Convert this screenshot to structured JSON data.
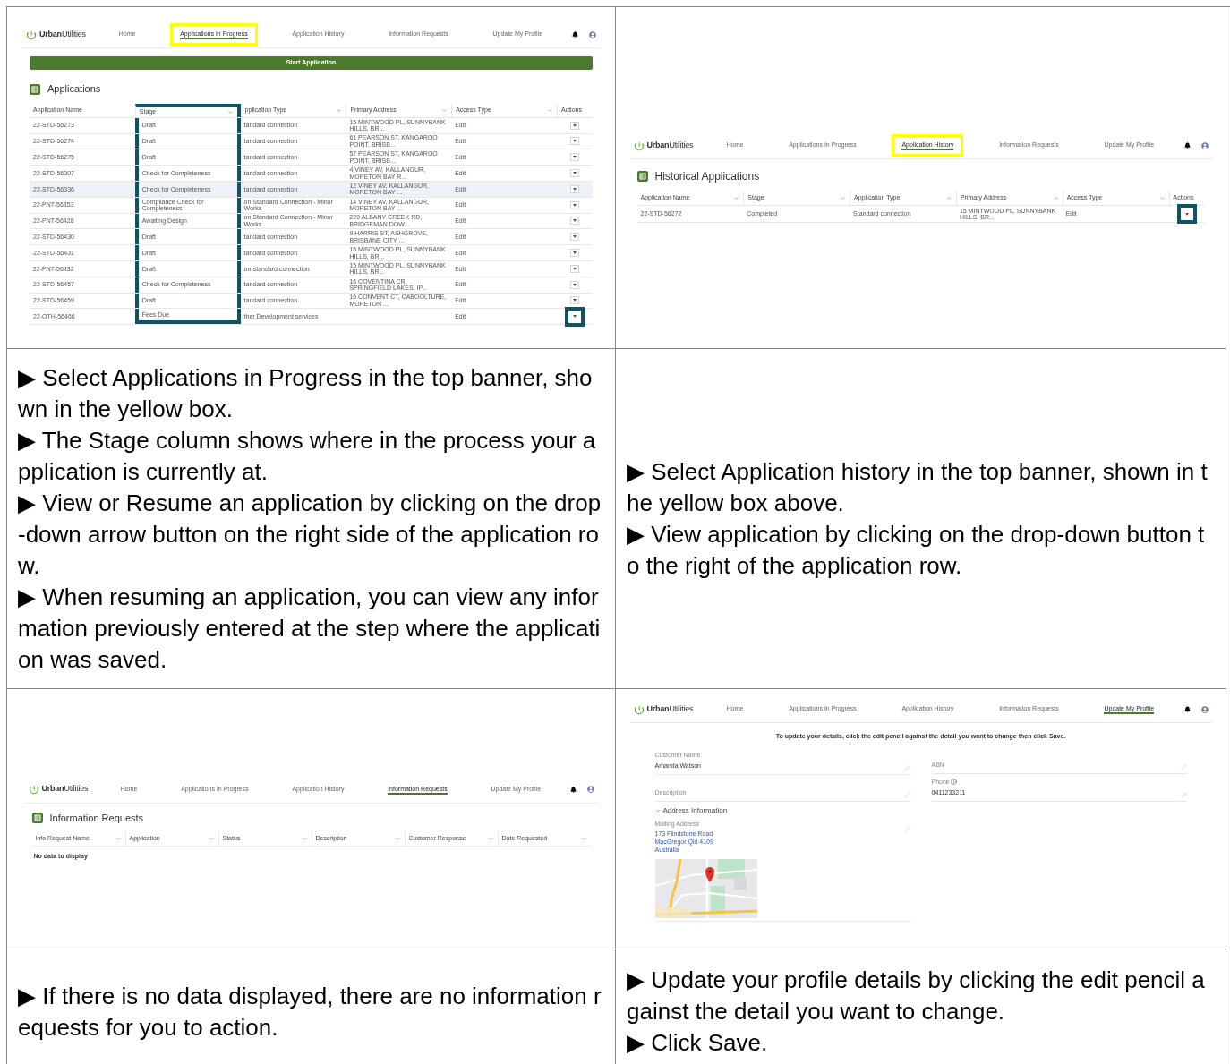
{
  "screens": [
    {
      "kind": "applications",
      "nav": {
        "logo": "**Urban**Utilities",
        "items": [
          {
            "label": "Home",
            "selected": false,
            "highlighted": false
          },
          {
            "label": "Applications In Progress",
            "selected": true,
            "highlighted": true
          },
          {
            "label": "Application History",
            "selected": false,
            "highlighted": false
          },
          {
            "label": "Information Requests",
            "selected": false,
            "highlighted": false
          },
          {
            "label": "Update My Profile",
            "selected": false,
            "highlighted": false
          }
        ]
      },
      "start_button": "Start Application",
      "title": "Applications",
      "columns": [
        {
          "label": "Application Name",
          "sortable": false,
          "highlighted": false
        },
        {
          "label": "Stage",
          "sortable": true,
          "highlighted": true
        },
        {
          "label": "pplication Type",
          "sortable": true,
          "highlighted": false
        },
        {
          "label": "Primary Address",
          "sortable": true,
          "highlighted": false
        },
        {
          "label": "Access Type",
          "sortable": true,
          "highlighted": false
        },
        {
          "label": "Actions",
          "sortable": false,
          "highlighted": false
        }
      ],
      "rows": [
        {
          "cells": [
            "22-STD-56273",
            "Draft",
            "tandard connection",
            "15 MINTWOOD PL, SUNNYBANK HILLS, BR...",
            "Edit"
          ],
          "selected": false,
          "action_highlighted": false
        },
        {
          "cells": [
            "22-STD-56274",
            "Draft",
            "tandard connection",
            "61 PEARSON ST, KANGAROO POINT, BRISB...",
            "Edit"
          ],
          "selected": false,
          "action_highlighted": false
        },
        {
          "cells": [
            "22-STD-56275",
            "Draft",
            "tandard connection",
            "57 PEARSON ST, KANGAROO POINT, BRISB...",
            "Edit"
          ],
          "selected": false,
          "action_highlighted": false
        },
        {
          "cells": [
            "22-STD-56307",
            "Check for Completeness",
            "tandard connection",
            "4 VINEY AV, KALLANGUR, MORETON BAY R...",
            "Edit"
          ],
          "selected": false,
          "action_highlighted": false
        },
        {
          "cells": [
            "22-STD-56336",
            "Check for Completeness",
            "tandard connection",
            "12 VINEY AV, KALLANGUR, MORETON BAY ...",
            "Edit"
          ],
          "selected": true,
          "action_highlighted": false
        },
        {
          "cells": [
            "22-PNT-56353",
            "Compliance Check for Completeness",
            "on Standard Connection - Minor Works",
            "14 VINEY AV, KALLANGUR, MORETON BAY ...",
            "Edit"
          ],
          "selected": false,
          "action_highlighted": false
        },
        {
          "cells": [
            "22-PNT-56428",
            "Awaiting Design",
            "on Standard Connection - Minor Works",
            "220 ALBANY CREEK RD, BRIDGEMAN DOW...",
            "Edit"
          ],
          "selected": false,
          "action_highlighted": false
        },
        {
          "cells": [
            "22-STD-56430",
            "Draft",
            "tandard connection",
            "9 HARRIS ST, ASHGROVE, BRISBANE CITY ...",
            "Edit"
          ],
          "selected": false,
          "action_highlighted": false
        },
        {
          "cells": [
            "22-STD-56431",
            "Draft",
            "tandard connection",
            "15 MINTWOOD PL, SUNNYBANK HILLS, BR...",
            "Edit"
          ],
          "selected": false,
          "action_highlighted": false
        },
        {
          "cells": [
            "22-PNT-56432",
            "Draft",
            "on-standard connection",
            "15 MINTWOOD PL, SUNNYBANK HILLS, BR...",
            "Edit"
          ],
          "selected": false,
          "action_highlighted": false
        },
        {
          "cells": [
            "22-STD-56457",
            "Check for Completeness",
            "tandard connection",
            "16 COVENTINA CR, SPRINGFIELD LAKES, IP...",
            "Edit"
          ],
          "selected": false,
          "action_highlighted": false
        },
        {
          "cells": [
            "22-STD-56459",
            "Draft",
            "tandard connection",
            "16 CONVENT CT, CABOOLTURE, MORETON ...",
            "Edit"
          ],
          "selected": false,
          "action_highlighted": false
        },
        {
          "cells": [
            "22-OTH-56466",
            "Fees Due",
            "ther Development services",
            "",
            "Edit"
          ],
          "selected": false,
          "action_highlighted": true
        }
      ]
    },
    {
      "kind": "history",
      "nav": {
        "logo": "**Urban**Utilities",
        "items": [
          {
            "label": "Home",
            "selected": false,
            "highlighted": false
          },
          {
            "label": "Applications In Progress",
            "selected": false,
            "highlighted": false
          },
          {
            "label": "Application History",
            "selected": true,
            "highlighted": true
          },
          {
            "label": "Information Requests",
            "selected": false,
            "highlighted": false
          },
          {
            "label": "Update My Profile",
            "selected": false,
            "highlighted": false
          }
        ]
      },
      "title": "Historical Applications",
      "columns": [
        {
          "label": "Application Name",
          "sortable": true,
          "highlighted": false
        },
        {
          "label": "Stage",
          "sortable": true,
          "highlighted": false
        },
        {
          "label": "Application Type",
          "sortable": true,
          "highlighted": false
        },
        {
          "label": "Primary Address",
          "sortable": true,
          "highlighted": false
        },
        {
          "label": "Access Type",
          "sortable": true,
          "highlighted": false
        },
        {
          "label": "Actions",
          "sortable": false,
          "highlighted": false
        }
      ],
      "rows": [
        {
          "cells": [
            "22-STD-56272",
            "Completed",
            "Standard connection",
            "15 MINTWOOD PL, SUNNYBANK HILLS, BR...",
            "Edit"
          ],
          "selected": false,
          "action_highlighted": true
        }
      ]
    },
    {
      "kind": "requests",
      "nav": {
        "logo": "**Urban**Utilities",
        "items": [
          {
            "label": "Home",
            "selected": false,
            "highlighted": false
          },
          {
            "label": "Applications In Progress",
            "selected": false,
            "highlighted": false
          },
          {
            "label": "Application History",
            "selected": false,
            "highlighted": false
          },
          {
            "label": "Information Requests",
            "selected": true,
            "highlighted": false
          },
          {
            "label": "Update My Profile",
            "selected": false,
            "highlighted": false
          }
        ]
      },
      "title": "Information Requests",
      "columns": [
        {
          "label": "Info Request Name",
          "sortable": true,
          "highlighted": false
        },
        {
          "label": "Application",
          "sortable": true,
          "highlighted": false
        },
        {
          "label": "Status",
          "sortable": true,
          "highlighted": false
        },
        {
          "label": "Description",
          "sortable": true,
          "highlighted": false
        },
        {
          "label": "Customer Response",
          "sortable": true,
          "highlighted": false
        },
        {
          "label": "Date Requested",
          "sortable": true,
          "highlighted": false
        }
      ],
      "empty_message": "No data to display"
    },
    {
      "kind": "profile",
      "nav": {
        "logo": "**Urban**Utilities",
        "items": [
          {
            "label": "Home",
            "selected": false,
            "highlighted": false
          },
          {
            "label": "Applications In Progress",
            "selected": false,
            "highlighted": false
          },
          {
            "label": "Application History",
            "selected": false,
            "highlighted": false
          },
          {
            "label": "Information Requests",
            "selected": false,
            "highlighted": false
          },
          {
            "label": "Update My Profile",
            "selected": true,
            "highlighted": false
          }
        ]
      },
      "instruction": "To update your details, click the edit pencil against the detail you want to change then click Save.",
      "fields_left": [
        {
          "label": "Customer Name",
          "value": "Amanda Watson",
          "info": false
        },
        {
          "label": "Description",
          "info": false
        }
      ],
      "fields_right": [
        {
          "label": "ABN",
          "info": false
        },
        {
          "label": "Phone",
          "value": "0411233211",
          "info": true
        }
      ],
      "section": {
        "title": "Address Information",
        "expanded": true
      },
      "mailing": {
        "label": "Mailing Address",
        "lines": [
          "173 Flindstone Road",
          "MacGregor Qld 4109",
          "Australia"
        ]
      }
    }
  ],
  "captions": [
    {
      "paragraphs": [
        "▶ Select Applications in Progress in the top banner, shown in the yellow box.",
        "▶ The Stage column shows where in the process your application is currently at.",
        "▶ View or Resume an application by clicking on the drop-down arrow button on the right side of the application row.",
        "▶ When resuming an application, you can view any information previously entered at the step where the application was saved."
      ]
    },
    {
      "paragraphs": [
        "▶ Select Application history in the top banner, shown in the yellow box above.",
        "▶ View application by clicking on the drop-down button to the right of the application row."
      ]
    },
    {
      "paragraphs": [
        "▶ If there is no data displayed, there are no information requests for you to action."
      ]
    },
    {
      "paragraphs": [
        "▶ Update your profile details by clicking the edit pencil against the detail you want to change.",
        "▶ Click Save."
      ]
    }
  ]
}
